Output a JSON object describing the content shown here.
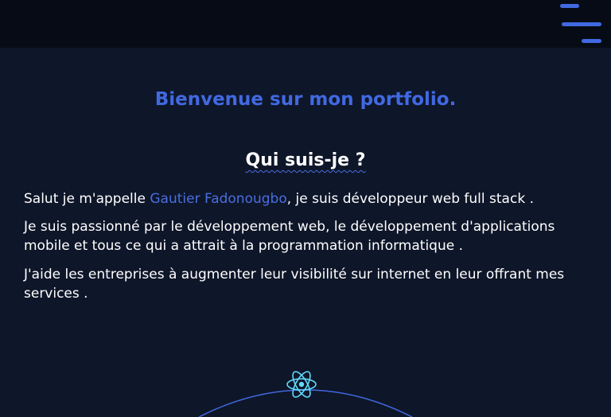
{
  "header": {
    "menu_icon": "hamburger-menu-icon",
    "accent": "#4169e1"
  },
  "hero": {
    "welcome": "Bienvenue sur mon portfolio."
  },
  "about": {
    "title": "Qui suis-je ?",
    "intro_prefix": "Salut je m'appelle ",
    "name": "Gautier Fadonougbo",
    "intro_suffix": ", je suis développeur web full stack .",
    "passion": "Je suis passionné par le développement web, le développement d'applications mobile et tous ce qui a attrait à la programmation informatique .",
    "help": "J'aide les entreprises à augmenter leur visibilité sur internet en leur offrant mes services ."
  },
  "skills": {
    "icon": "react-icon",
    "icon_color": "#61dafb"
  }
}
